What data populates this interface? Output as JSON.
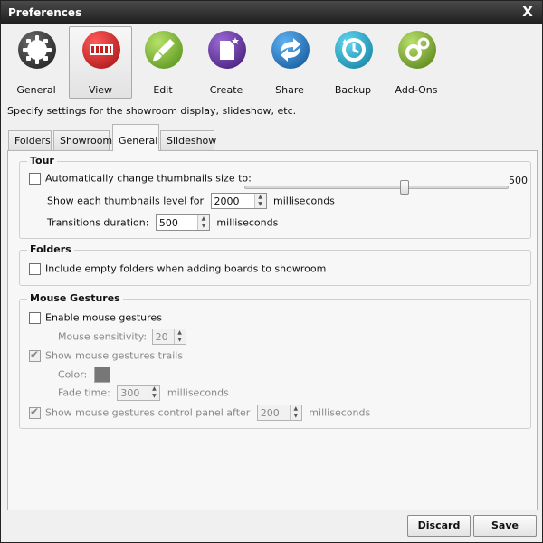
{
  "window": {
    "title": "Preferences",
    "close_label": "X"
  },
  "toolbar": {
    "items": [
      {
        "label": "General",
        "icon": "gear-badge-icon",
        "color": "#2f2f2f"
      },
      {
        "label": "View",
        "icon": "filmstrip-icon",
        "color": "#c21f1f"
      },
      {
        "label": "Edit",
        "icon": "brush-icon",
        "color": "#6aa024"
      },
      {
        "label": "Create",
        "icon": "new-document-icon",
        "color": "#5b2a94"
      },
      {
        "label": "Share",
        "icon": "share-arrows-icon",
        "color": "#1c79c9"
      },
      {
        "label": "Backup",
        "icon": "backup-clock-icon",
        "color": "#1aa6c8"
      },
      {
        "label": "Add-Ons",
        "icon": "addon-gears-icon",
        "color": "#7aa62a"
      }
    ]
  },
  "description": "Specify settings for the showroom display, slideshow, etc.",
  "tabs": [
    "Folders",
    "Showroom",
    "General",
    "Slideshow"
  ],
  "tour": {
    "title": "Tour",
    "auto_thumb_label": "Automatically change thumbnails size to:",
    "auto_thumb_checked": false,
    "slider_value": 500,
    "slider_fraction": 0.61,
    "slider_value_label": "500",
    "level_label": "Show each thumbnails level for",
    "level_value": "2000",
    "level_unit": "milliseconds",
    "transition_label": "Transitions duration:",
    "transition_value": "500",
    "transition_unit": "milliseconds"
  },
  "folders": {
    "title": "Folders",
    "include_empty_label": "Include empty folders when adding boards to showroom"
  },
  "gestures": {
    "title": "Mouse Gestures",
    "enable_label": "Enable mouse gestures",
    "sensitivity_label": "Mouse sensitivity:",
    "sensitivity_value": "20",
    "trails_label": "Show mouse gestures trails",
    "color_label": "Color:",
    "swatch_color": "#777777",
    "fade_label": "Fade time:",
    "fade_value": "300",
    "fade_unit": "milliseconds",
    "panel_label": "Show mouse gestures control panel after",
    "panel_value": "200",
    "panel_unit": "milliseconds"
  },
  "buttons": {
    "discard": "Discard",
    "save": "Save"
  }
}
